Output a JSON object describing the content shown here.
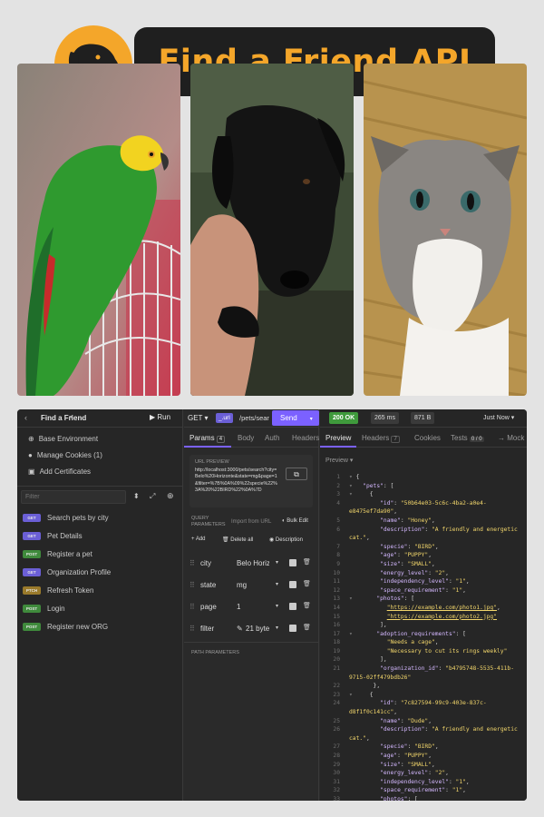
{
  "banner": {
    "title": "Find a Friend API"
  },
  "colors": {
    "accent": "#f4a62a",
    "run": "#7b61ff",
    "ok": "#3f9a3c"
  },
  "app": {
    "breadcrumb_back": "‹",
    "project": "Find a Friend",
    "run_label": "Run",
    "sidebar": {
      "menu": [
        {
          "icon": "globe-icon",
          "label": "Base Environment"
        },
        {
          "icon": "cookie-icon",
          "label": "Manage Cookies (1)"
        },
        {
          "icon": "certificate-icon",
          "label": "Add Certificates"
        }
      ],
      "filter_placeholder": "Filter",
      "requests": [
        {
          "method": "GET",
          "label": "Search pets by city"
        },
        {
          "method": "GET",
          "label": "Pet Details"
        },
        {
          "method": "POST",
          "label": "Register a pet"
        },
        {
          "method": "GET",
          "label": "Organization Profile"
        },
        {
          "method": "PTCH",
          "label": "Refresh Token"
        },
        {
          "method": "POST",
          "label": "Login"
        },
        {
          "method": "POST",
          "label": "Register new ORG"
        }
      ]
    },
    "request": {
      "method": "GET",
      "url_chip": "_.url",
      "url_text": "/pets/sear",
      "send": "Send",
      "tabs": {
        "params": "Params",
        "params_count": "4",
        "body": "Body",
        "auth": "Auth",
        "headers": "Headers"
      },
      "url_preview_label": "URL PREVIEW",
      "url_preview": "http://localhost:3000/pets/search?city=Belo%20Horizonte&state=mg&page=1&filter=%7B%0A%09%22specie%22%3A%20%22BIRD%22%0A%7D",
      "query_label": "QUERY PARAMETERS",
      "import_label": "Import from URL",
      "bulk_label": "Bulk Edit",
      "add_label": "Add",
      "delete_label": "Delete all",
      "description_label": "Description",
      "params": [
        {
          "name": "city",
          "value": "Belo Horiz"
        },
        {
          "name": "state",
          "value": "mg"
        },
        {
          "name": "page",
          "value": "1"
        },
        {
          "name": "filter",
          "value": "21 byte"
        }
      ],
      "path_label": "PATH PARAMETERS"
    },
    "response": {
      "status": "200 OK",
      "time": "265 ms",
      "size": "871 B",
      "when": "Just Now",
      "tabs": {
        "preview": "Preview",
        "headers": "Headers",
        "headers_count": "7",
        "cookies": "Cookies",
        "tests": "Tests",
        "tests_count": "0 / 0",
        "mock": "→ Mock"
      },
      "sub_label": "Preview"
    }
  }
}
